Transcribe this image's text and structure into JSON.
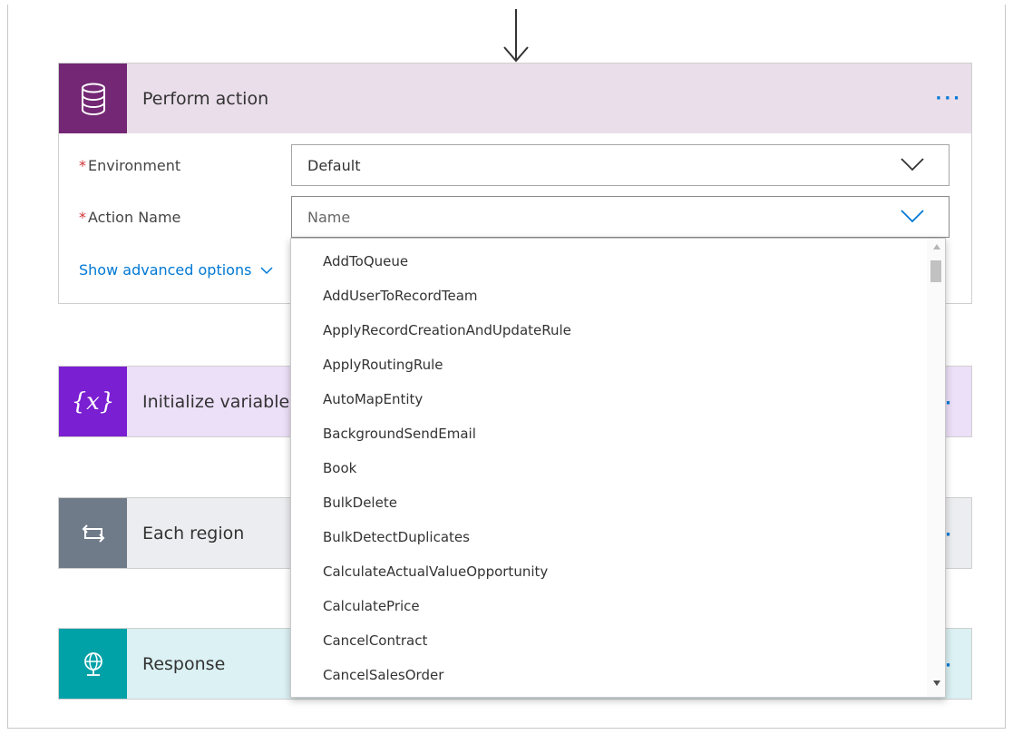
{
  "colors": {
    "perform_header": "#eadeea",
    "perform_icon": "#742774",
    "init_header": "#ecdff8",
    "init_icon": "#7a1fd1",
    "each_header": "#ecedf0",
    "each_icon": "#707b89",
    "response_header": "#dbf1f3",
    "response_icon": "#00a2a8",
    "link": "#0078d4",
    "required": "#d13438"
  },
  "perform": {
    "icon": "database-icon",
    "title": "Perform action",
    "more": "···",
    "environment": {
      "required_mark": "*",
      "label": "Environment",
      "value": "Default"
    },
    "action_name": {
      "required_mark": "*",
      "label": "Action Name",
      "placeholder": "Name"
    },
    "advanced_link": "Show advanced options"
  },
  "init": {
    "icon": "variable-icon",
    "icon_text": "{x}",
    "title": "Initialize variable"
  },
  "each": {
    "icon": "loop-icon",
    "title": "Each region"
  },
  "response": {
    "icon": "globe-icon",
    "title": "Response"
  },
  "dropdown": {
    "items": [
      "AddToQueue",
      "AddUserToRecordTeam",
      "ApplyRecordCreationAndUpdateRule",
      "ApplyRoutingRule",
      "AutoMapEntity",
      "BackgroundSendEmail",
      "Book",
      "BulkDelete",
      "BulkDetectDuplicates",
      "CalculateActualValueOpportunity",
      "CalculatePrice",
      "CancelContract",
      "CancelSalesOrder"
    ]
  }
}
